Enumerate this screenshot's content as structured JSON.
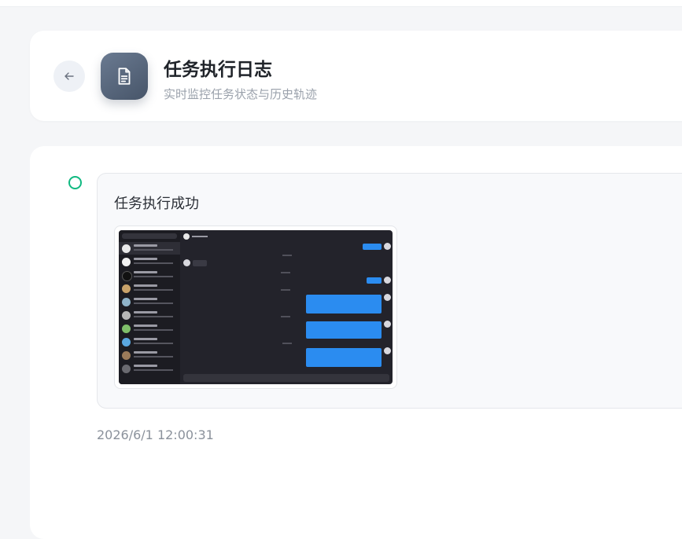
{
  "header": {
    "title": "任务执行日志",
    "subtitle": "实时监控任务状态与历史轨迹",
    "back_icon": "arrow-left-icon",
    "app_icon": "document-icon"
  },
  "log": {
    "status_title": "任务执行成功",
    "timestamp": "2026/6/1 12:00:31",
    "status_color": "#10b981",
    "screenshot_alt": "chat app screenshot"
  },
  "colors": {
    "accent_dark": "#475569",
    "bubble_blue": "#2b8cf0",
    "success": "#10b981"
  }
}
